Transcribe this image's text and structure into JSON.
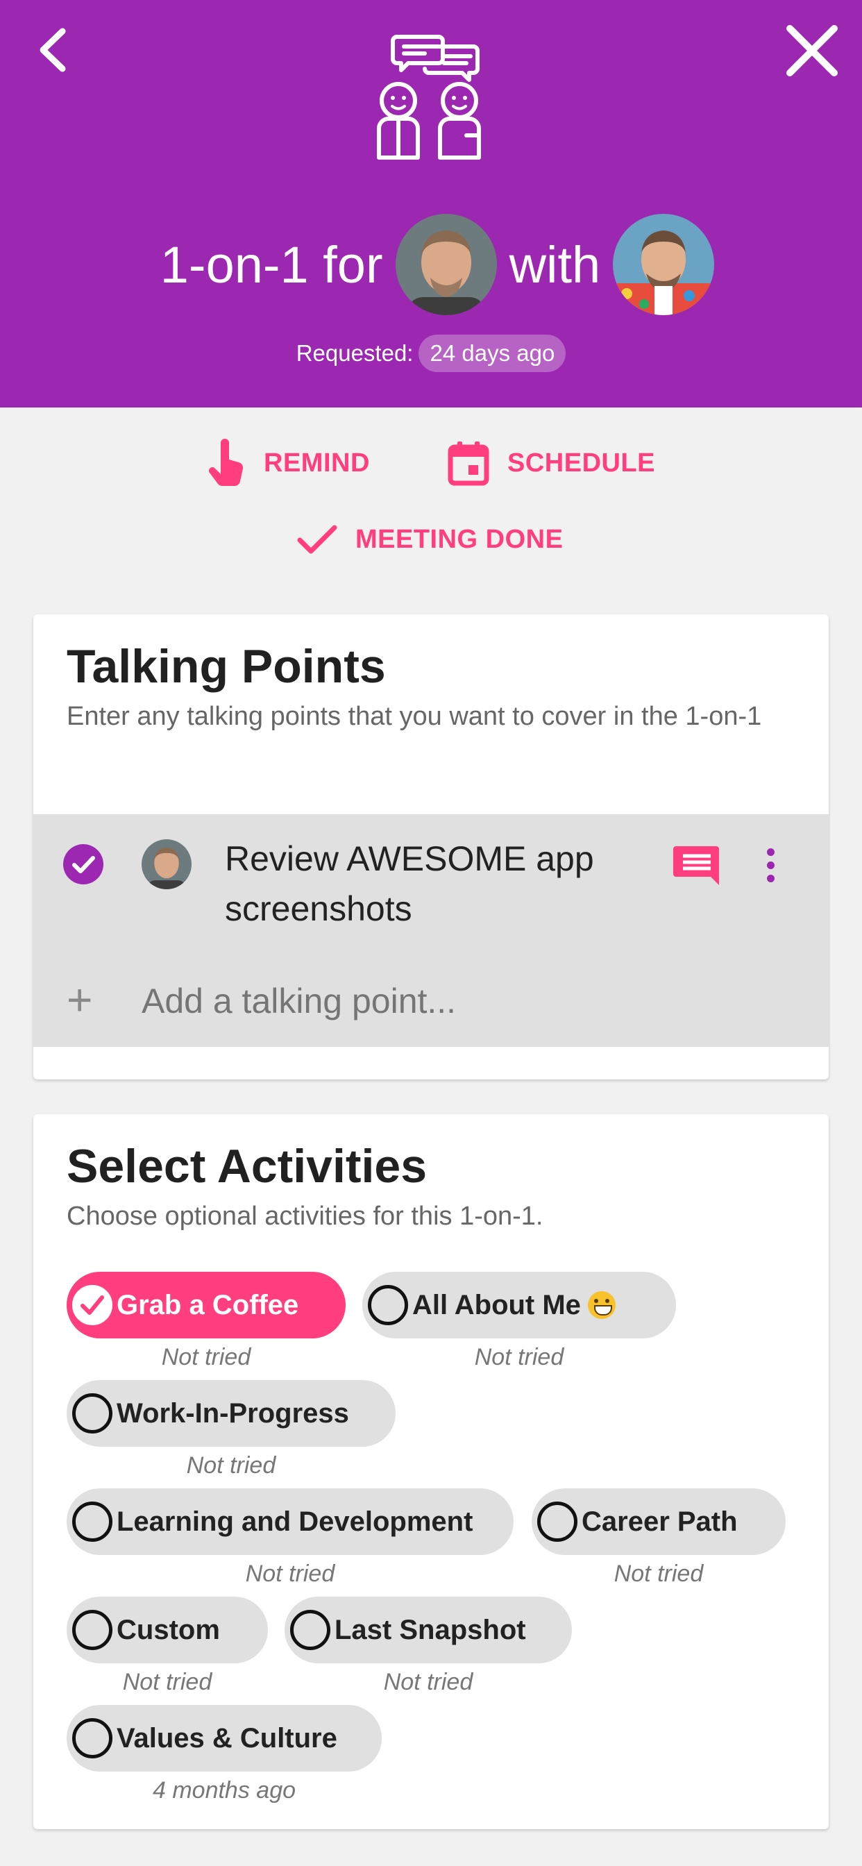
{
  "header": {
    "title_prefix": "1-on-1 for",
    "title_with": "with",
    "requested_label": "Requested:",
    "requested_value": "24 days ago",
    "background_color": "#9c27b0"
  },
  "actions": {
    "remind": "REMIND",
    "schedule": "SCHEDULE",
    "done": "MEETING DONE",
    "accent_color": "#ff3d7f"
  },
  "talking_points": {
    "title": "Talking Points",
    "description": "Enter any talking points that you want to cover in the 1-on-1",
    "items": [
      {
        "text": "Review AWESOME app screenshots",
        "completed": true
      }
    ],
    "add_placeholder": "Add a talking point..."
  },
  "activities": {
    "title": "Select Activities",
    "description": "Choose optional activities for this 1-on-1.",
    "items": [
      {
        "label": "Grab a Coffee",
        "status": "Not tried",
        "selected": true
      },
      {
        "label": "All About Me",
        "status": "Not tried",
        "selected": false,
        "emoji": "grinning-face"
      },
      {
        "label": "Work-In-Progress",
        "status": "Not tried",
        "selected": false
      },
      {
        "label": "Learning and Development",
        "status": "Not tried",
        "selected": false
      },
      {
        "label": "Career Path",
        "status": "Not tried",
        "selected": false
      },
      {
        "label": "Custom",
        "status": "Not tried",
        "selected": false
      },
      {
        "label": "Last Snapshot",
        "status": "Not tried",
        "selected": false
      },
      {
        "label": "Values & Culture",
        "status": "4 months ago",
        "selected": false
      }
    ]
  },
  "icons": {
    "back": "chevron-left-icon",
    "close": "close-icon",
    "hero": "conversation-people-icon",
    "remind": "tap-finger-icon",
    "schedule": "calendar-icon",
    "done": "checkmark-icon",
    "comment": "comment-icon",
    "more": "more-vert-icon",
    "add": "plus-icon"
  }
}
